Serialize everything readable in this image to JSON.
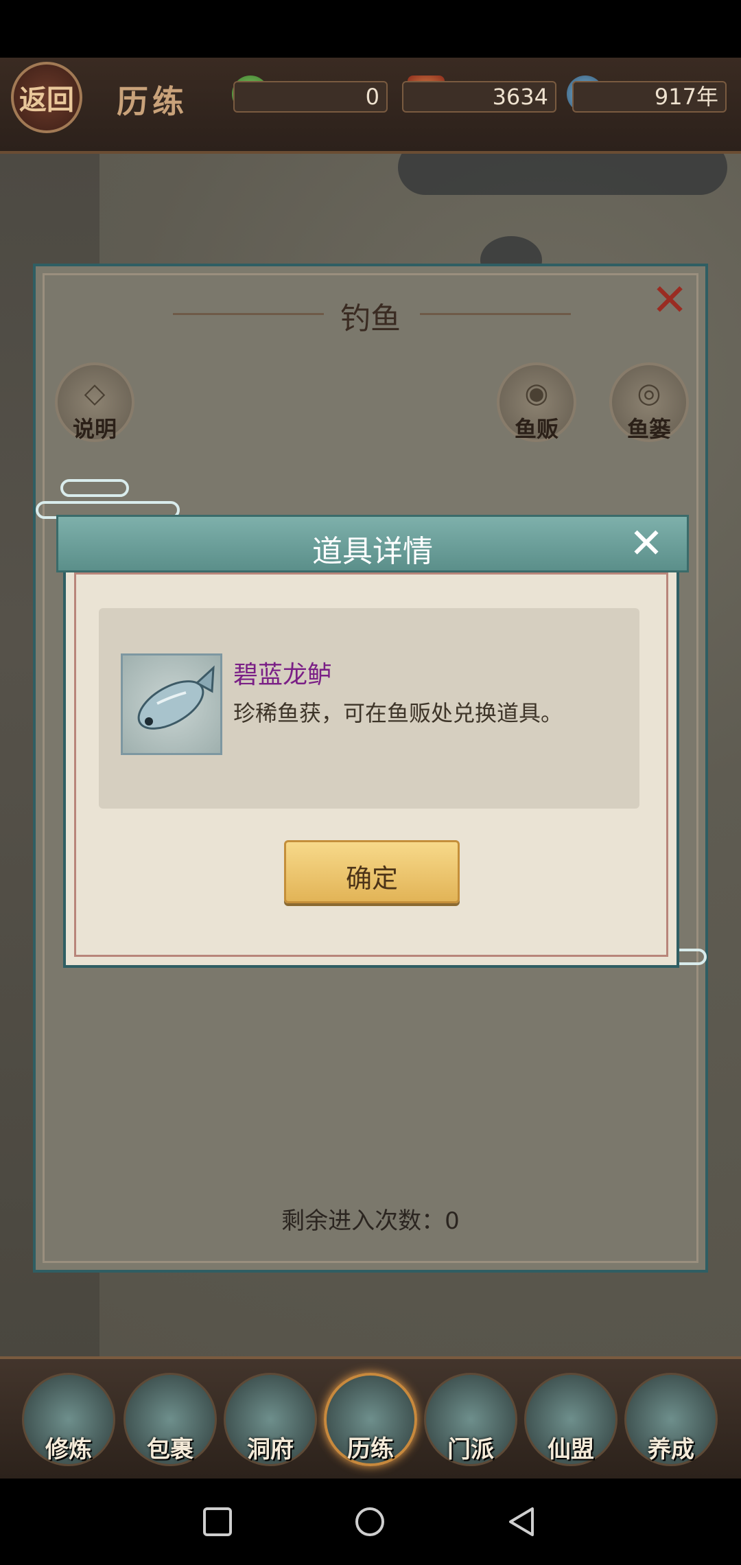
{
  "top_bar": {
    "back_label": "返回",
    "title": "历练",
    "resources": [
      {
        "icon": "jade-icon",
        "value": "0"
      },
      {
        "icon": "pouch-icon",
        "value": "3634"
      },
      {
        "icon": "hourglass-icon",
        "value": "917年"
      }
    ]
  },
  "fishing_panel": {
    "title": "钓鱼",
    "buttons": {
      "instructions": "说明",
      "fish_vendor": "鱼贩",
      "fish_basket": "鱼篓"
    },
    "remaining_entries": "剩余进入次数：0"
  },
  "item_modal": {
    "title": "道具详情",
    "item_name": "碧蓝龙鲈",
    "item_description": "珍稀鱼获，可在鱼贩处兑换道具。",
    "confirm_label": "确定"
  },
  "bottom_nav": [
    {
      "label": "修炼",
      "icon": "cultivator-icon"
    },
    {
      "label": "包裹",
      "icon": "bag-icon"
    },
    {
      "label": "洞府",
      "icon": "cave-dwelling-icon"
    },
    {
      "label": "历练",
      "icon": "scroll-icon"
    },
    {
      "label": "门派",
      "icon": "sect-gate-icon"
    },
    {
      "label": "仙盟",
      "icon": "alliance-icon"
    },
    {
      "label": "养成",
      "icon": "pentagram-icon"
    }
  ],
  "colors": {
    "modal_header": "#6ea19c",
    "item_name": "#7a1f86",
    "confirm_button": "#e9c46a",
    "close_x_fishing": "#9a2c22"
  }
}
